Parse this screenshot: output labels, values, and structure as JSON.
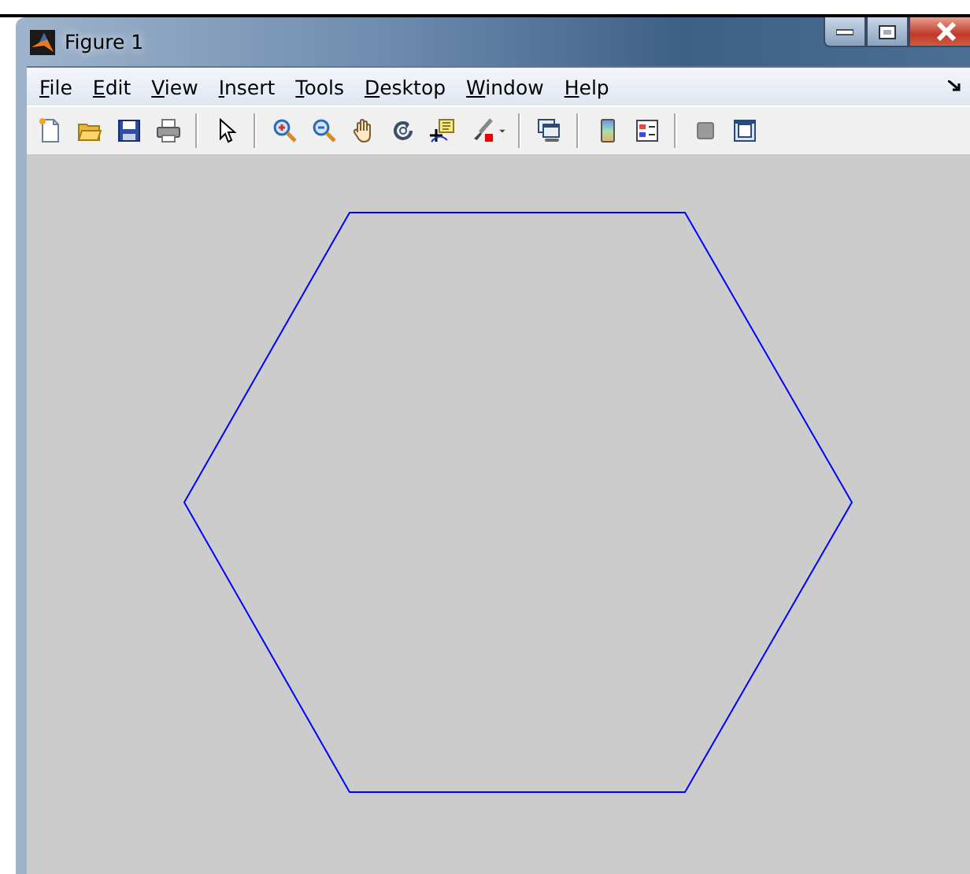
{
  "window": {
    "title": "Figure 1"
  },
  "menu": [
    {
      "label": "File"
    },
    {
      "label": "Edit"
    },
    {
      "label": "View"
    },
    {
      "label": "Insert"
    },
    {
      "label": "Tools"
    },
    {
      "label": "Desktop"
    },
    {
      "label": "Window"
    },
    {
      "label": "Help"
    }
  ]
}
